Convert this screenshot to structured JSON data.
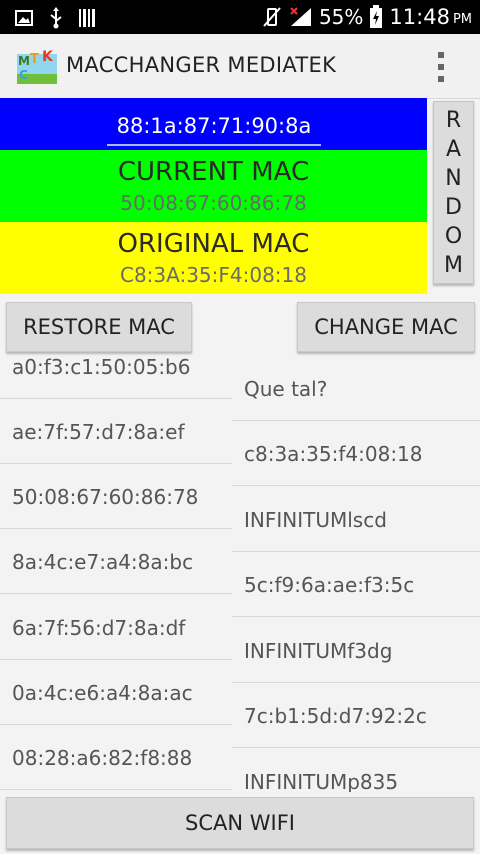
{
  "status_bar": {
    "battery": "55%",
    "time": "11:48",
    "ampm": "PM"
  },
  "app": {
    "title": "MACCHANGER MEDIATEK",
    "icon_letters": [
      "M",
      "T",
      "K",
      "C"
    ]
  },
  "mac": {
    "input_value": "88:1a:87:71:90:8a",
    "current_label": "CURRENT MAC",
    "current_value": "50:08:67:60:86:78",
    "original_label": "ORIGINAL MAC",
    "original_value": "C8:3A:35:F4:08:18",
    "colors": {
      "input_bg": "#0000ff",
      "current_bg": "#00ff00",
      "original_bg": "#ffff00"
    }
  },
  "buttons": {
    "random": [
      "R",
      "A",
      "N",
      "D",
      "O",
      "M"
    ],
    "restore": "RESTORE MAC",
    "change": "CHANGE MAC",
    "scan": "SCAN WIFI"
  },
  "left_list": [
    "a0:f3:c1:50:05:b6",
    "ae:7f:57:d7:8a:ef",
    "50:08:67:60:86:78",
    "8a:4c:e7:a4:8a:bc",
    "6a:7f:56:d7:8a:df",
    "0a:4c:e6:a4:8a:ac",
    "08:28:a6:82:f8:88"
  ],
  "right_list": [
    "Que tal?",
    "c8:3a:35:f4:08:18",
    "INFINITUMlscd",
    "5c:f9:6a:ae:f3:5c",
    "INFINITUMf3dg",
    "7c:b1:5d:d7:92:2c",
    "INFINITUMp835"
  ]
}
